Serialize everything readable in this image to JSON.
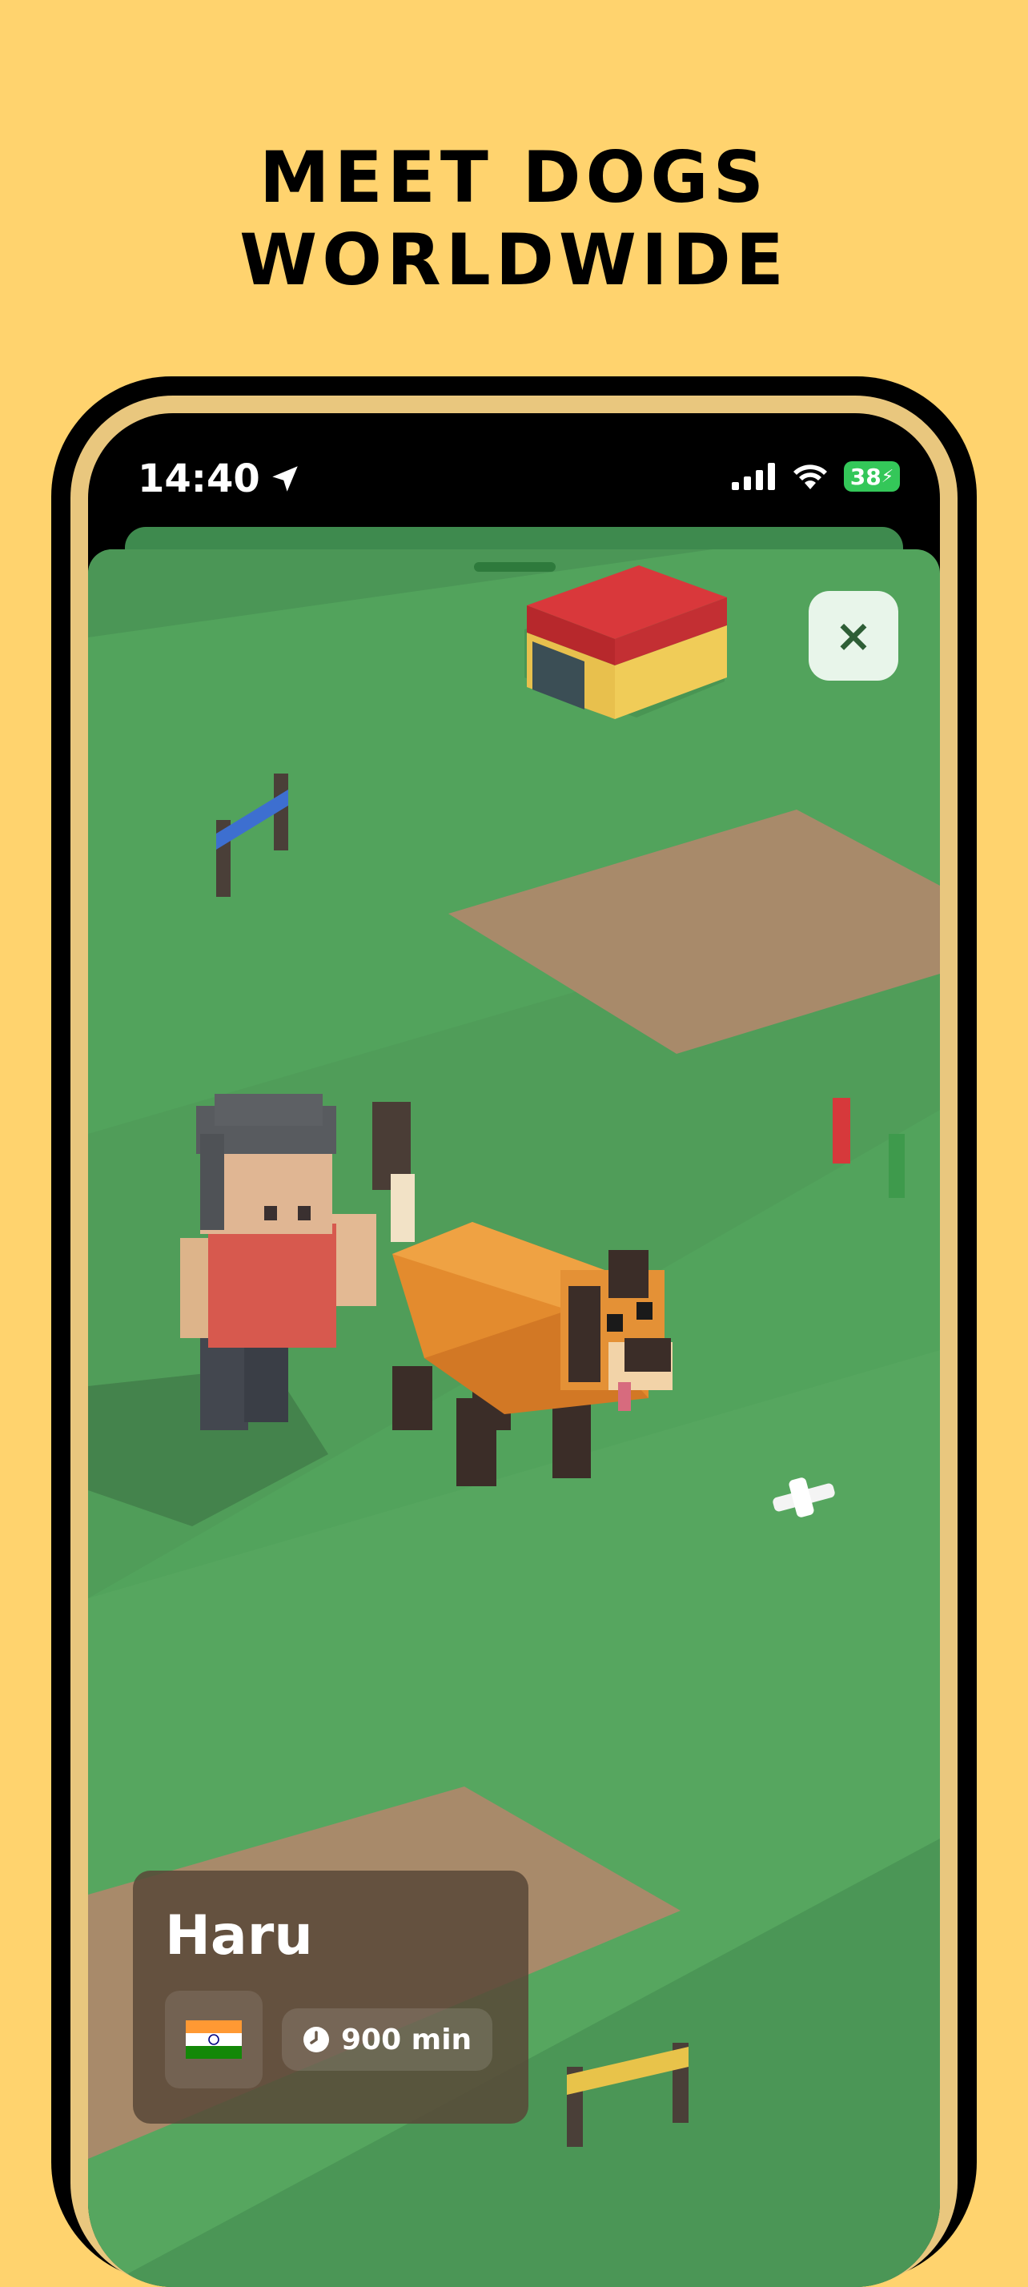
{
  "headline": "MEET DOGS WORLDWIDE",
  "status_bar": {
    "time": "14:40",
    "battery": "38"
  },
  "game": {
    "close_label": "×"
  },
  "profile_card": {
    "name": "Haru",
    "country_flag": "india-flag-icon",
    "walk_time": "900 min"
  }
}
